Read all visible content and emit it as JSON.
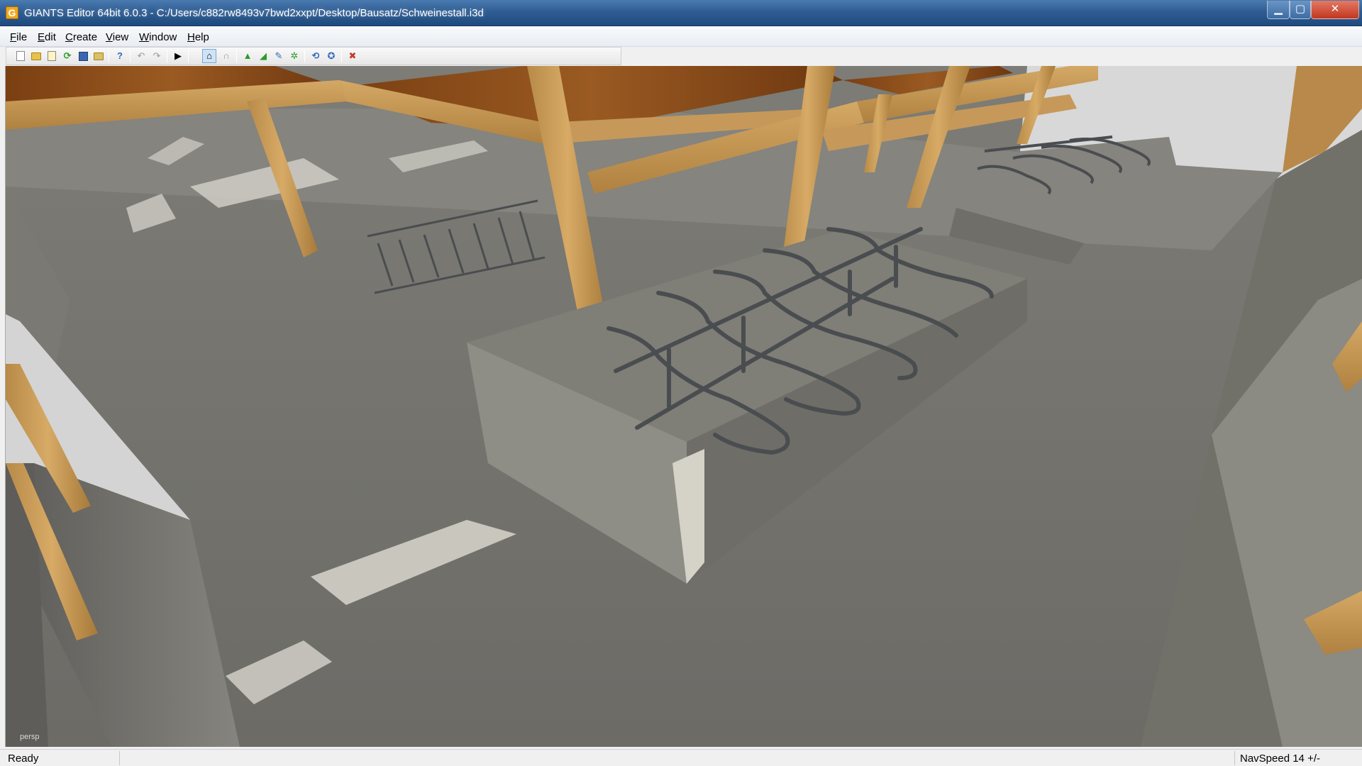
{
  "window": {
    "title": "GIANTS Editor 64bit 6.0.3 - C:/Users/c882rw8493v7bwd2xxpt/Desktop/Bausatz/Schweinestall.i3d",
    "icon": "giants-app-icon",
    "controls": {
      "minimize": "▁",
      "maximize": "▢",
      "close": "✕"
    }
  },
  "menu": [
    {
      "key": "F",
      "rest": "ile"
    },
    {
      "key": "E",
      "rest": "dit"
    },
    {
      "key": "C",
      "rest": "reate"
    },
    {
      "key": "V",
      "rest": "iew"
    },
    {
      "key": "W",
      "rest": "indow"
    },
    {
      "key": "H",
      "rest": "elp"
    }
  ],
  "toolbar": {
    "icons": [
      "new-file-icon",
      "open-folder-icon",
      "edit-file-icon",
      "refresh-icon",
      "save-icon",
      "export-icon",
      "help-icon",
      "undo-icon",
      "redo-icon",
      "play-icon",
      "home-view-icon",
      "magnet-icon",
      "terrain-paint-icon",
      "terrain-sculpt-icon",
      "foliage-icon",
      "plant-icon",
      "rotate-icon",
      "rotate-settings-icon",
      "delete-icon"
    ],
    "glyphs": {
      "undo": "↶",
      "redo": "↷",
      "play": "▶",
      "magnet": "∩",
      "refresh": "⟳",
      "delete": "✖"
    }
  },
  "viewport": {
    "camera_label": "persp"
  },
  "status": {
    "left": "Ready",
    "right": "NavSpeed 14 +/-"
  },
  "colors": {
    "title_bar": "#2f5d93",
    "wood": "#c99a55",
    "roof": "#8a4a17",
    "concrete": "#8a8880",
    "floor": "#6f6e69",
    "rail": "#4a4d50"
  }
}
